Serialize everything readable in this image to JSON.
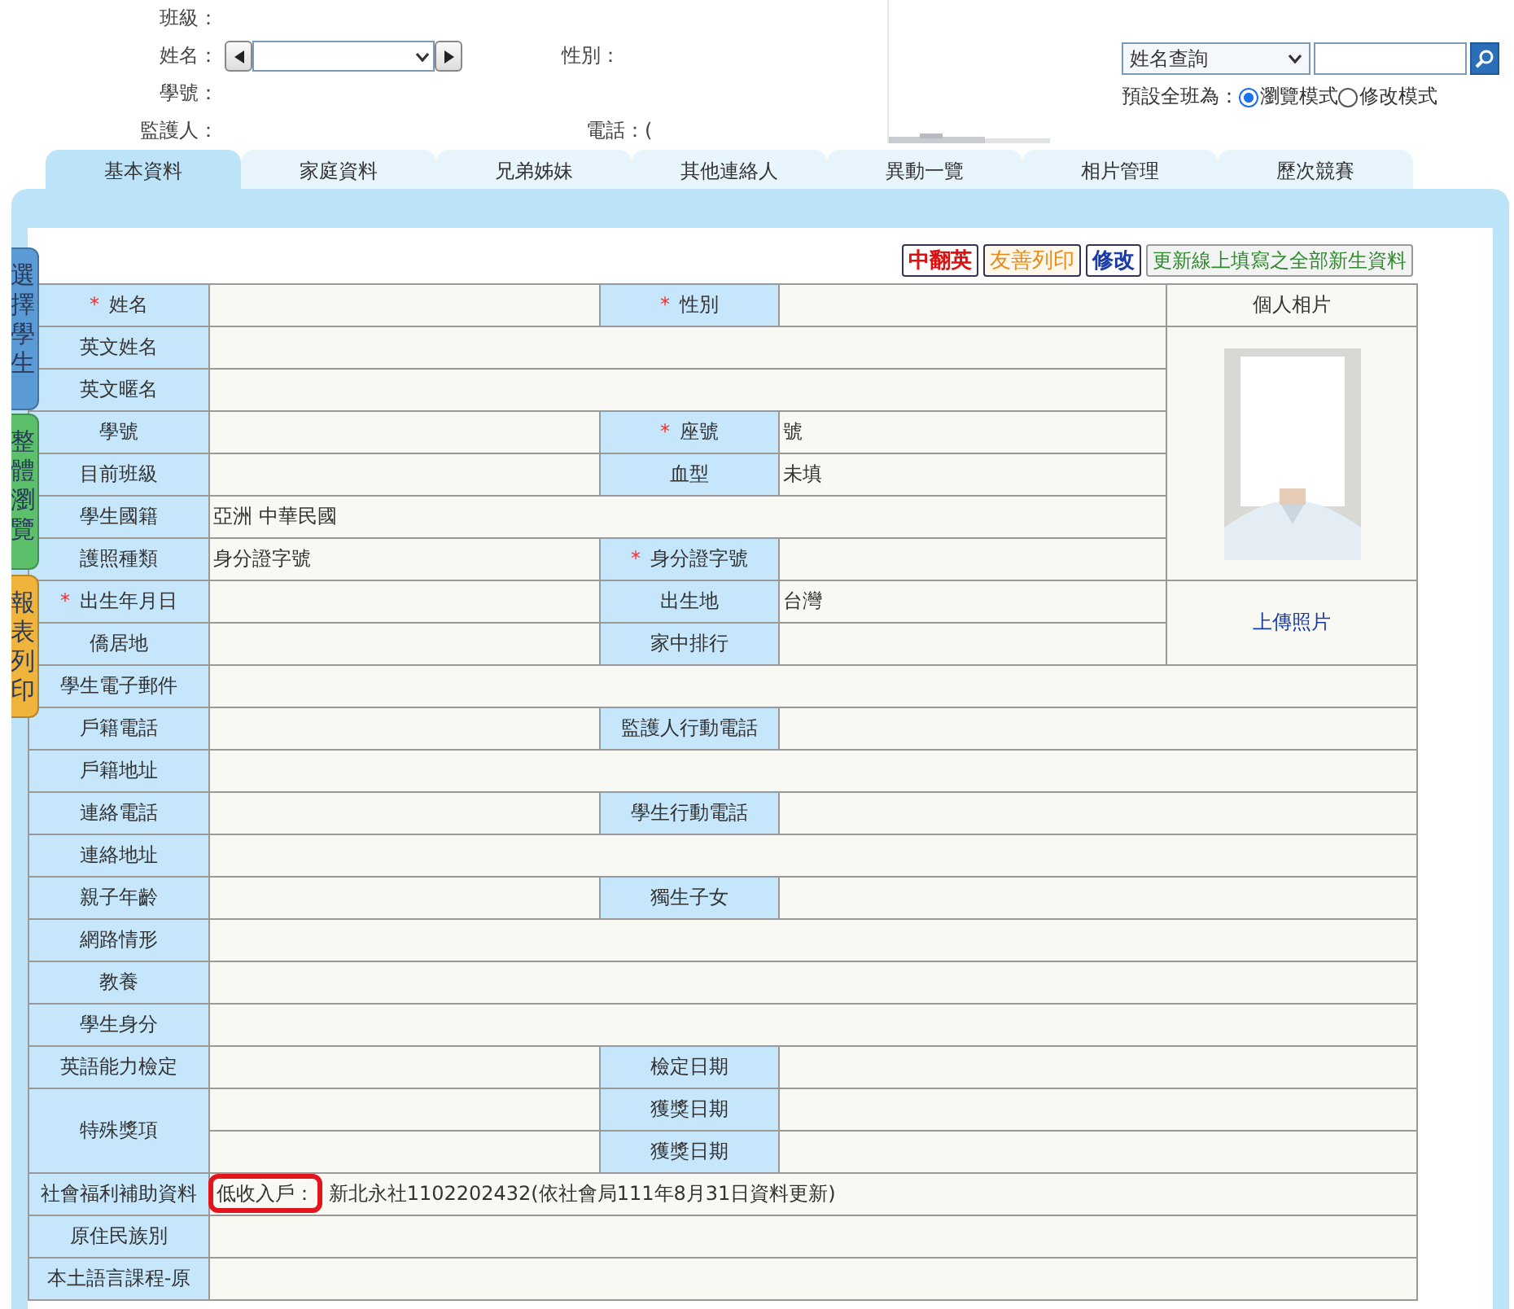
{
  "student_form": {
    "class_label": "班級：",
    "name_label": "姓名：",
    "id_label": "學號：",
    "guardian_label": "監護人：",
    "gender_label": "性別：",
    "phone_label": "電話：("
  },
  "search": {
    "mode": "姓名查詢"
  },
  "default_mode": {
    "label": "預設全班為：",
    "options": [
      {
        "label": "瀏覽模式",
        "selected": true
      },
      {
        "label": "修改模式",
        "selected": false
      }
    ]
  },
  "tabs": [
    {
      "label": "基本資料",
      "selected": true
    },
    {
      "label": "家庭資料",
      "selected": false
    },
    {
      "label": "兄弟姊妹",
      "selected": false
    },
    {
      "label": "其他連絡人",
      "selected": false
    },
    {
      "label": "異動一覽",
      "selected": false
    },
    {
      "label": "相片管理",
      "selected": false
    },
    {
      "label": "歷次競賽",
      "selected": false
    }
  ],
  "side_tabs": [
    {
      "label": "選擇學生",
      "color": "#5b9bd5"
    },
    {
      "label": "整體瀏覽",
      "color": "#5cc06a"
    },
    {
      "label": "報表列印",
      "color": "#f0b43c"
    }
  ],
  "actions": [
    {
      "label": "中翻英",
      "kind": "translate"
    },
    {
      "label": "友善列印",
      "kind": "print"
    },
    {
      "label": "修改",
      "kind": "edit"
    },
    {
      "label": "更新線上填寫之全部新生資料",
      "kind": "update"
    }
  ],
  "photo": {
    "header": "個人相片",
    "upload": "上傳照片"
  },
  "required_mark": "*",
  "rows": [
    {
      "label": "姓名",
      "required": true,
      "label2": "性別",
      "required2": true
    },
    {
      "label": "英文姓名",
      "required": false
    },
    {
      "label": "英文暱名",
      "required": false
    },
    {
      "label": "學號",
      "required": false,
      "label2": "座號",
      "required2": true,
      "value2": "號"
    },
    {
      "label": "目前班級",
      "required": false,
      "label2": "血型",
      "required2": false,
      "value2": "未填"
    },
    {
      "label": "學生國籍",
      "required": false,
      "value": "亞洲 中華民國"
    },
    {
      "label": "護照種類",
      "required": false,
      "value": "身分證字號",
      "label2": "身分證字號",
      "required2": true
    },
    {
      "label": "出生年月日",
      "required": true,
      "label2": "出生地",
      "required2": false,
      "value2": "台灣"
    },
    {
      "label": "僑居地",
      "required": false,
      "label2": "家中排行",
      "required2": false
    },
    {
      "label": "學生電子郵件",
      "required": false
    },
    {
      "label": "戶籍電話",
      "required": false,
      "label2": "監護人行動電話",
      "required2": false
    },
    {
      "label": "戶籍地址",
      "required": false
    },
    {
      "label": "連絡電話",
      "required": false,
      "label2": "學生行動電話",
      "required2": false
    },
    {
      "label": "連絡地址",
      "required": false
    },
    {
      "label": "親子年齡",
      "required": false,
      "label2": "獨生子女",
      "required2": false
    },
    {
      "label": "網路情形",
      "required": false
    },
    {
      "label": "教養",
      "required": false
    },
    {
      "label": "學生身分",
      "required": false
    },
    {
      "label": "英語能力檢定",
      "required": false,
      "label2": "檢定日期",
      "required2": false
    },
    {
      "label": "特殊獎項",
      "required": false,
      "sub_rows": [
        {
          "label2": "獲獎日期"
        },
        {
          "label2": "獲獎日期"
        }
      ]
    },
    {
      "label": "社會福利補助資料",
      "required": false,
      "value_tag": "低收入戶：",
      "value": "新北永社1102202432(依社會局111年8月31日資料更新)"
    },
    {
      "label": "原住民族別",
      "required": false
    },
    {
      "label": "本土語言課程-原",
      "required": false
    }
  ]
}
